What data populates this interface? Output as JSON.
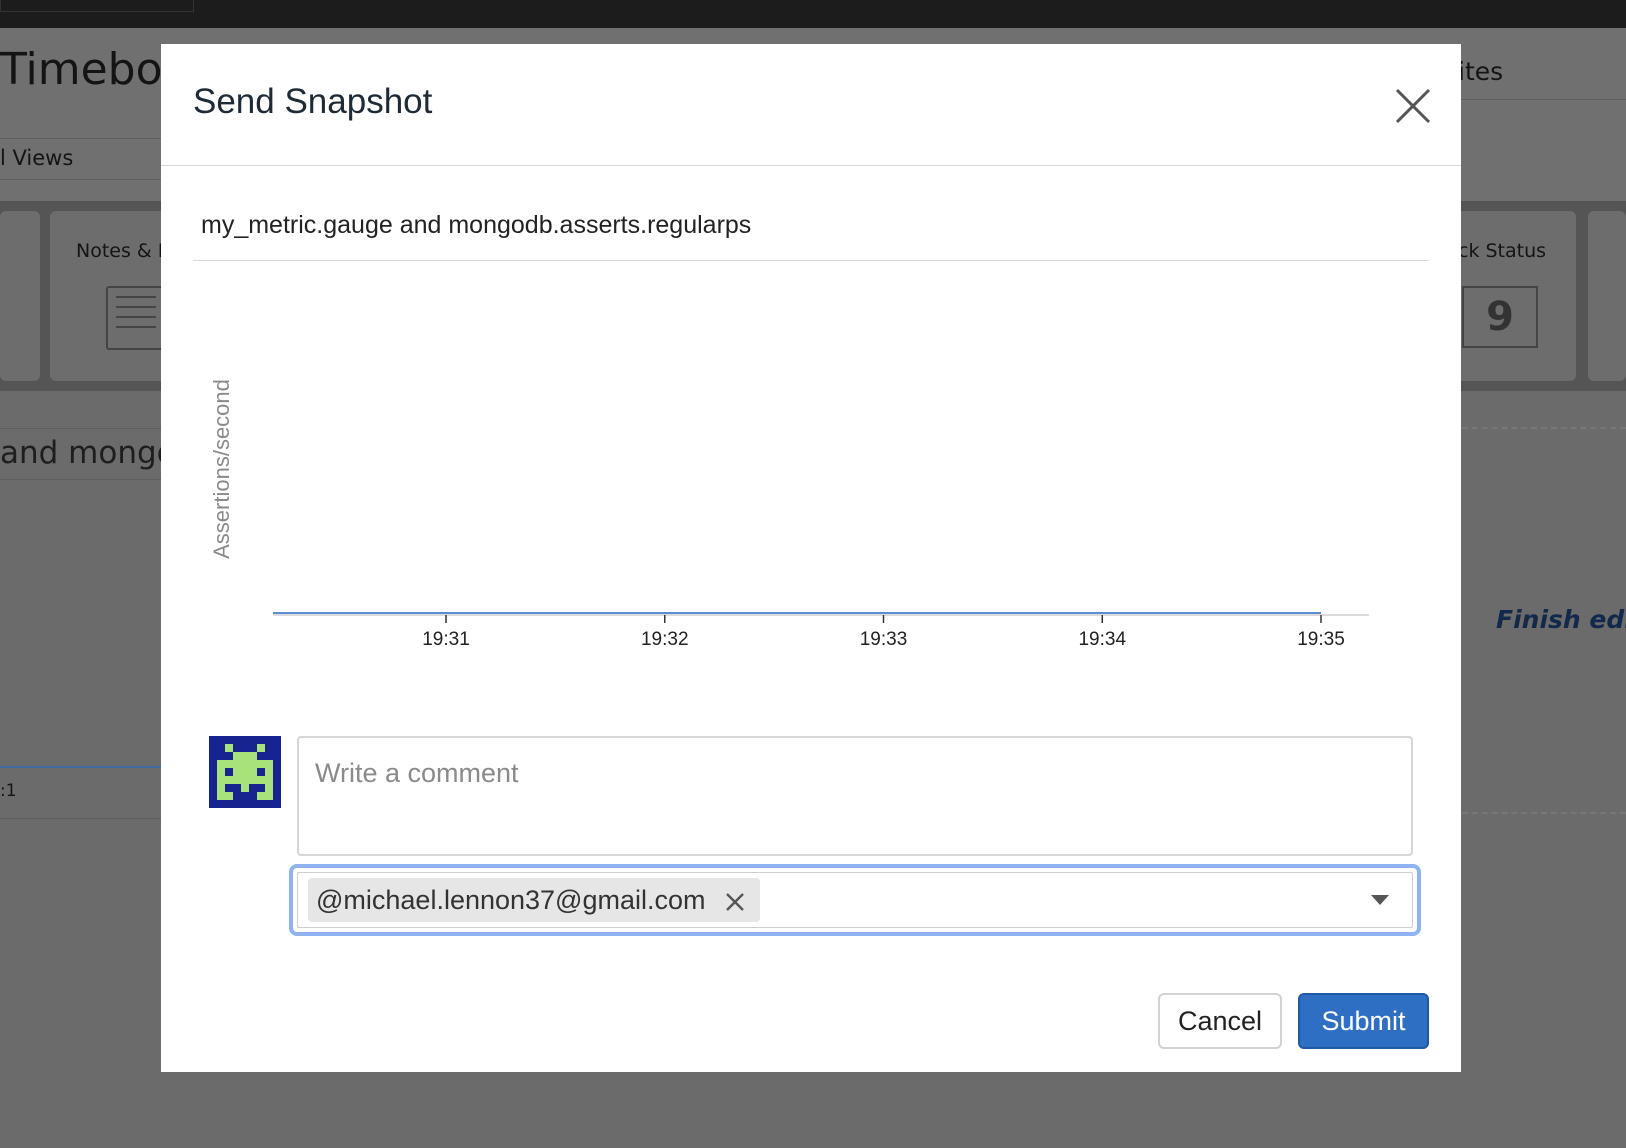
{
  "background": {
    "title_fragment": "Timebo",
    "views_fragment": "l Views",
    "right_header_fragment": "ites",
    "card_left_label": "Notes & I",
    "card_right_label": "ck Status",
    "card_right_value": "9",
    "widget_title_fragment": "and mongod",
    "tick_fragment": ":1",
    "finish_edit_fragment": "Finish edit"
  },
  "modal": {
    "title": "Send Snapshot",
    "graph_title": "my_metric.gauge and mongodb.asserts.regularps",
    "comment_placeholder": "Write a comment",
    "recipient_tag": "@michael.lennon37@gmail.com",
    "cancel_label": "Cancel",
    "submit_label": "Submit"
  },
  "chart_data": {
    "type": "line",
    "ylabel": "Assertions/second",
    "xlabel": "",
    "x_ticks": [
      "19:31",
      "19:32",
      "19:33",
      "19:34",
      "19:35"
    ],
    "series": [
      {
        "color": "#5b8dd6",
        "x": [
          "19:30:32",
          "19:35"
        ],
        "y": [
          0,
          0
        ]
      }
    ]
  },
  "colors": {
    "accent": "#2e6fc4",
    "focus_ring": "#8fb2f0",
    "avatar_bg": "#17238f",
    "avatar_fg": "#a7e27a"
  },
  "icons": {
    "close": "close-icon",
    "tag_remove": "remove-tag-icon",
    "dropdown": "chevron-down-icon",
    "avatar": "pixel-invader-avatar"
  }
}
